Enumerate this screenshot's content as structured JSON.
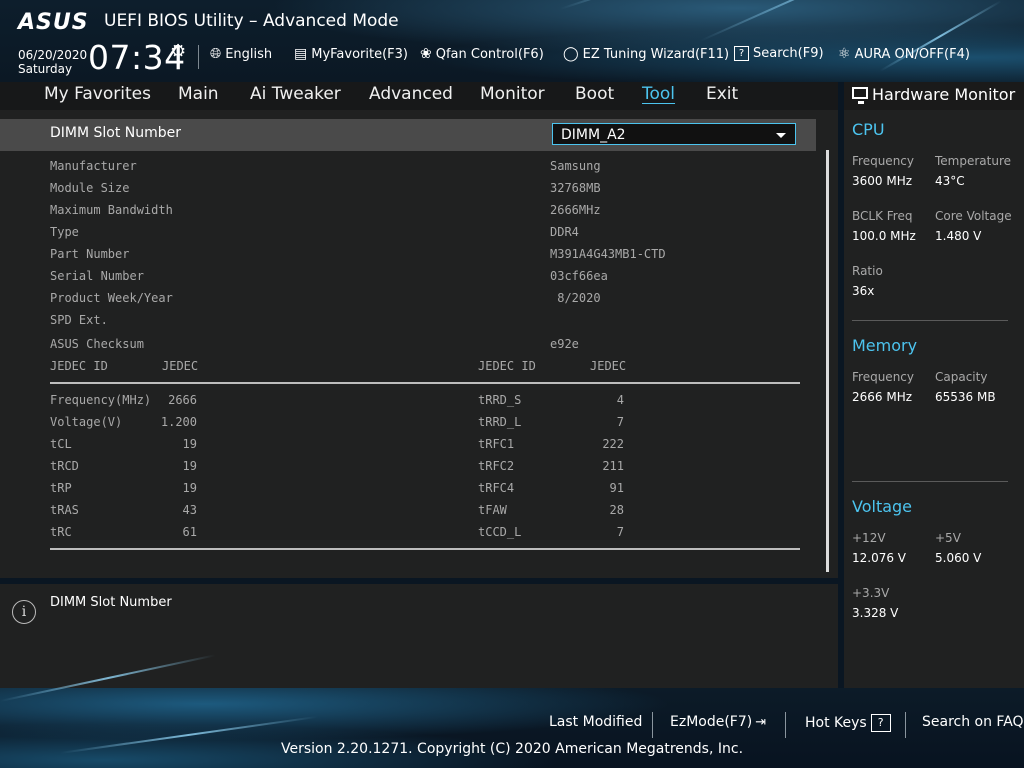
{
  "header": {
    "logo": "ASUS",
    "title": "UEFI BIOS Utility – Advanced Mode",
    "date": "06/20/2020",
    "weekday": "Saturday",
    "time": "07:34",
    "toolbar": [
      {
        "label": "English",
        "icon": "globe-icon"
      },
      {
        "label": "MyFavorite(F3)",
        "icon": "favorite-list-icon"
      },
      {
        "label": "Qfan Control(F6)",
        "icon": "fan-icon"
      },
      {
        "label": "EZ Tuning Wizard(F11)",
        "icon": "bulb-icon"
      },
      {
        "label": "Search(F9)",
        "icon": "help-box-icon"
      },
      {
        "label": "AURA ON/OFF(F4)",
        "icon": "aura-icon"
      }
    ]
  },
  "menu": {
    "items": [
      "My Favorites",
      "Main",
      "Ai Tweaker",
      "Advanced",
      "Monitor",
      "Boot",
      "Tool",
      "Exit"
    ],
    "active": "Tool"
  },
  "dimm": {
    "label": "DIMM Slot Number",
    "selected": "DIMM_A2"
  },
  "module_info": [
    {
      "label": "Manufacturer",
      "value": "Samsung"
    },
    {
      "label": "Module Size",
      "value": "32768MB"
    },
    {
      "label": "Maximum Bandwidth",
      "value": "2666MHz"
    },
    {
      "label": "Type",
      "value": "DDR4"
    },
    {
      "label": "Part Number",
      "value": "M391A4G43MB1-CTD"
    },
    {
      "label": "Serial Number",
      "value": "03cf66ea"
    },
    {
      "label": "Product Week/Year",
      "value": " 8/2020"
    },
    {
      "label": "SPD Ext.",
      "value": ""
    },
    {
      "label": "ASUS Checksum",
      "value": "e92e"
    }
  ],
  "jedec": {
    "left_header": [
      "JEDEC ID",
      "JEDEC"
    ],
    "right_header": [
      "JEDEC ID",
      "JEDEC"
    ],
    "left_rows": [
      {
        "label": "Frequency(MHz)",
        "value": "2666"
      },
      {
        "label": "Voltage(V)",
        "value": "1.200"
      },
      {
        "label": "tCL",
        "value": "19"
      },
      {
        "label": "tRCD",
        "value": "19"
      },
      {
        "label": "tRP",
        "value": "19"
      },
      {
        "label": "tRAS",
        "value": "43"
      },
      {
        "label": "tRC",
        "value": "61"
      }
    ],
    "right_rows": [
      {
        "label": "tRRD_S",
        "value": "4"
      },
      {
        "label": "tRRD_L",
        "value": "7"
      },
      {
        "label": "tRFC1",
        "value": "222"
      },
      {
        "label": "tRFC2",
        "value": "211"
      },
      {
        "label": "tRFC4",
        "value": "91"
      },
      {
        "label": "tFAW",
        "value": "28"
      },
      {
        "label": "tCCD_L",
        "value": "7"
      }
    ]
  },
  "help": {
    "text": "DIMM Slot Number"
  },
  "hardware_monitor": {
    "title": "Hardware Monitor",
    "cpu": {
      "title": "CPU",
      "frequency_label": "Frequency",
      "frequency": "3600 MHz",
      "temperature_label": "Temperature",
      "temperature": "43°C",
      "bclk_label": "BCLK Freq",
      "bclk": "100.0 MHz",
      "core_voltage_label": "Core Voltage",
      "core_voltage": "1.480 V",
      "ratio_label": "Ratio",
      "ratio": "36x"
    },
    "memory": {
      "title": "Memory",
      "frequency_label": "Frequency",
      "frequency": "2666 MHz",
      "capacity_label": "Capacity",
      "capacity": "65536 MB"
    },
    "voltage": {
      "title": "Voltage",
      "v12_label": "+12V",
      "v12": "12.076 V",
      "v5_label": "+5V",
      "v5": "5.060 V",
      "v33_label": "+3.3V",
      "v33": "3.328 V"
    }
  },
  "footer": {
    "last_modified": "Last Modified",
    "ez_mode": "EzMode(F7)",
    "hot_keys": "Hot Keys",
    "search_faq": "Search on FAQ",
    "copyright": "Version 2.20.1271. Copyright (C) 2020 American Megatrends, Inc."
  },
  "colors": {
    "accent": "#4cc4ef",
    "panel": "#202121",
    "highlight_row": "#4a4a4a"
  }
}
